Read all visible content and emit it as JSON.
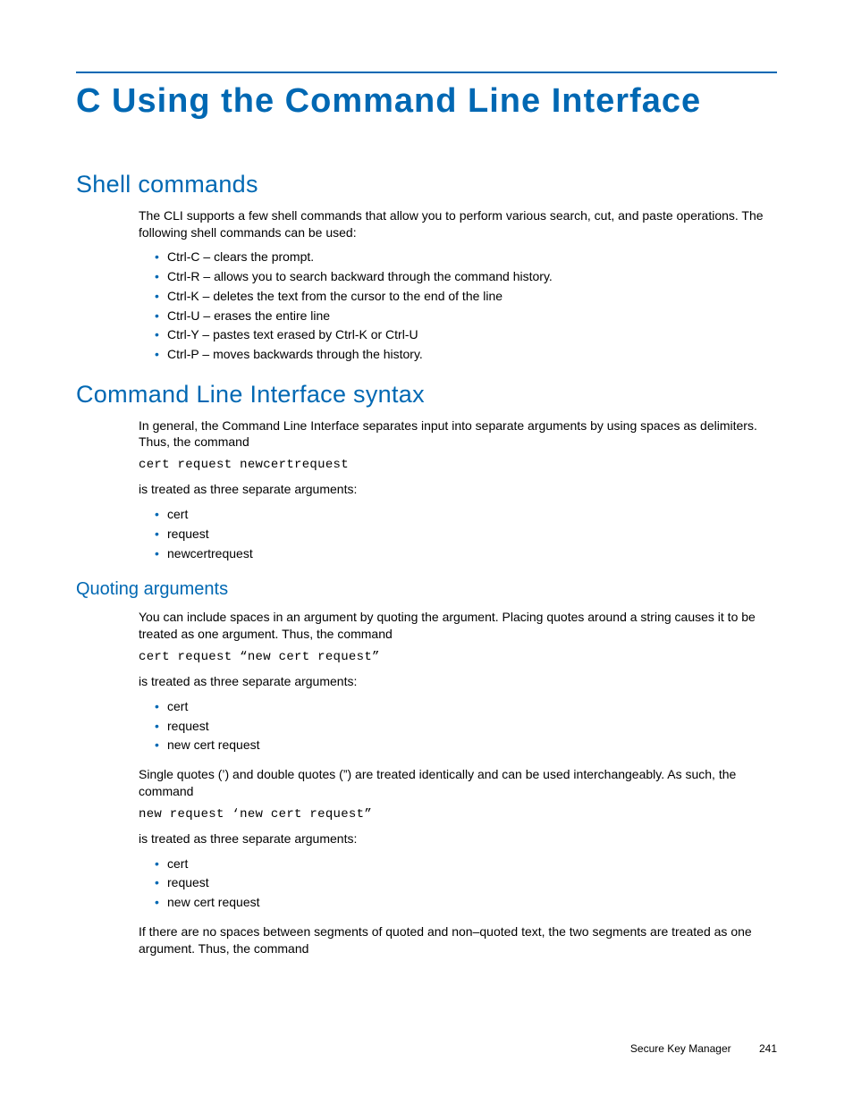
{
  "title": "C Using the Command Line Interface",
  "section1": {
    "heading": "Shell commands",
    "intro": "The CLI supports a few shell commands that allow you to perform various search, cut, and paste operations. The following shell commands can be used:",
    "items": [
      "Ctrl-C – clears the prompt.",
      "Ctrl-R – allows you to search backward through the command history.",
      "Ctrl-K – deletes the text from the cursor to the end of the line",
      "Ctrl-U – erases the entire line",
      "Ctrl-Y – pastes text erased by Ctrl-K or Ctrl-U",
      "Ctrl-P – moves backwards through the history."
    ]
  },
  "section2": {
    "heading": "Command Line Interface syntax",
    "intro": "In general, the Command Line Interface separates input into separate arguments by using spaces as delimiters. Thus, the command",
    "code1": "cert request newcertrequest",
    "after_code1": "is treated as three separate arguments:",
    "items1": [
      "cert",
      "request",
      "newcertrequest"
    ],
    "sub": {
      "heading": "Quoting arguments",
      "p1": "You can include spaces in an argument by quoting the argument. Placing quotes around a string causes it to be treated as one argument. Thus, the command",
      "code2": "cert request “new cert request”",
      "after_code2": "is treated as three separate arguments:",
      "items2": [
        "cert",
        "request",
        "new cert request"
      ],
      "p2": "Single quotes (’) and double quotes (”) are treated identically and can be used interchangeably. As such, the command",
      "code3": "new request ‘new cert request”",
      "after_code3": "is treated as three separate arguments:",
      "items3": [
        "cert",
        "request",
        "new cert request"
      ],
      "p3": "If there are no spaces between segments of quoted and non–quoted text, the two segments are treated as one argument. Thus, the command"
    }
  },
  "footer": {
    "doc": "Secure Key Manager",
    "page": "241"
  }
}
